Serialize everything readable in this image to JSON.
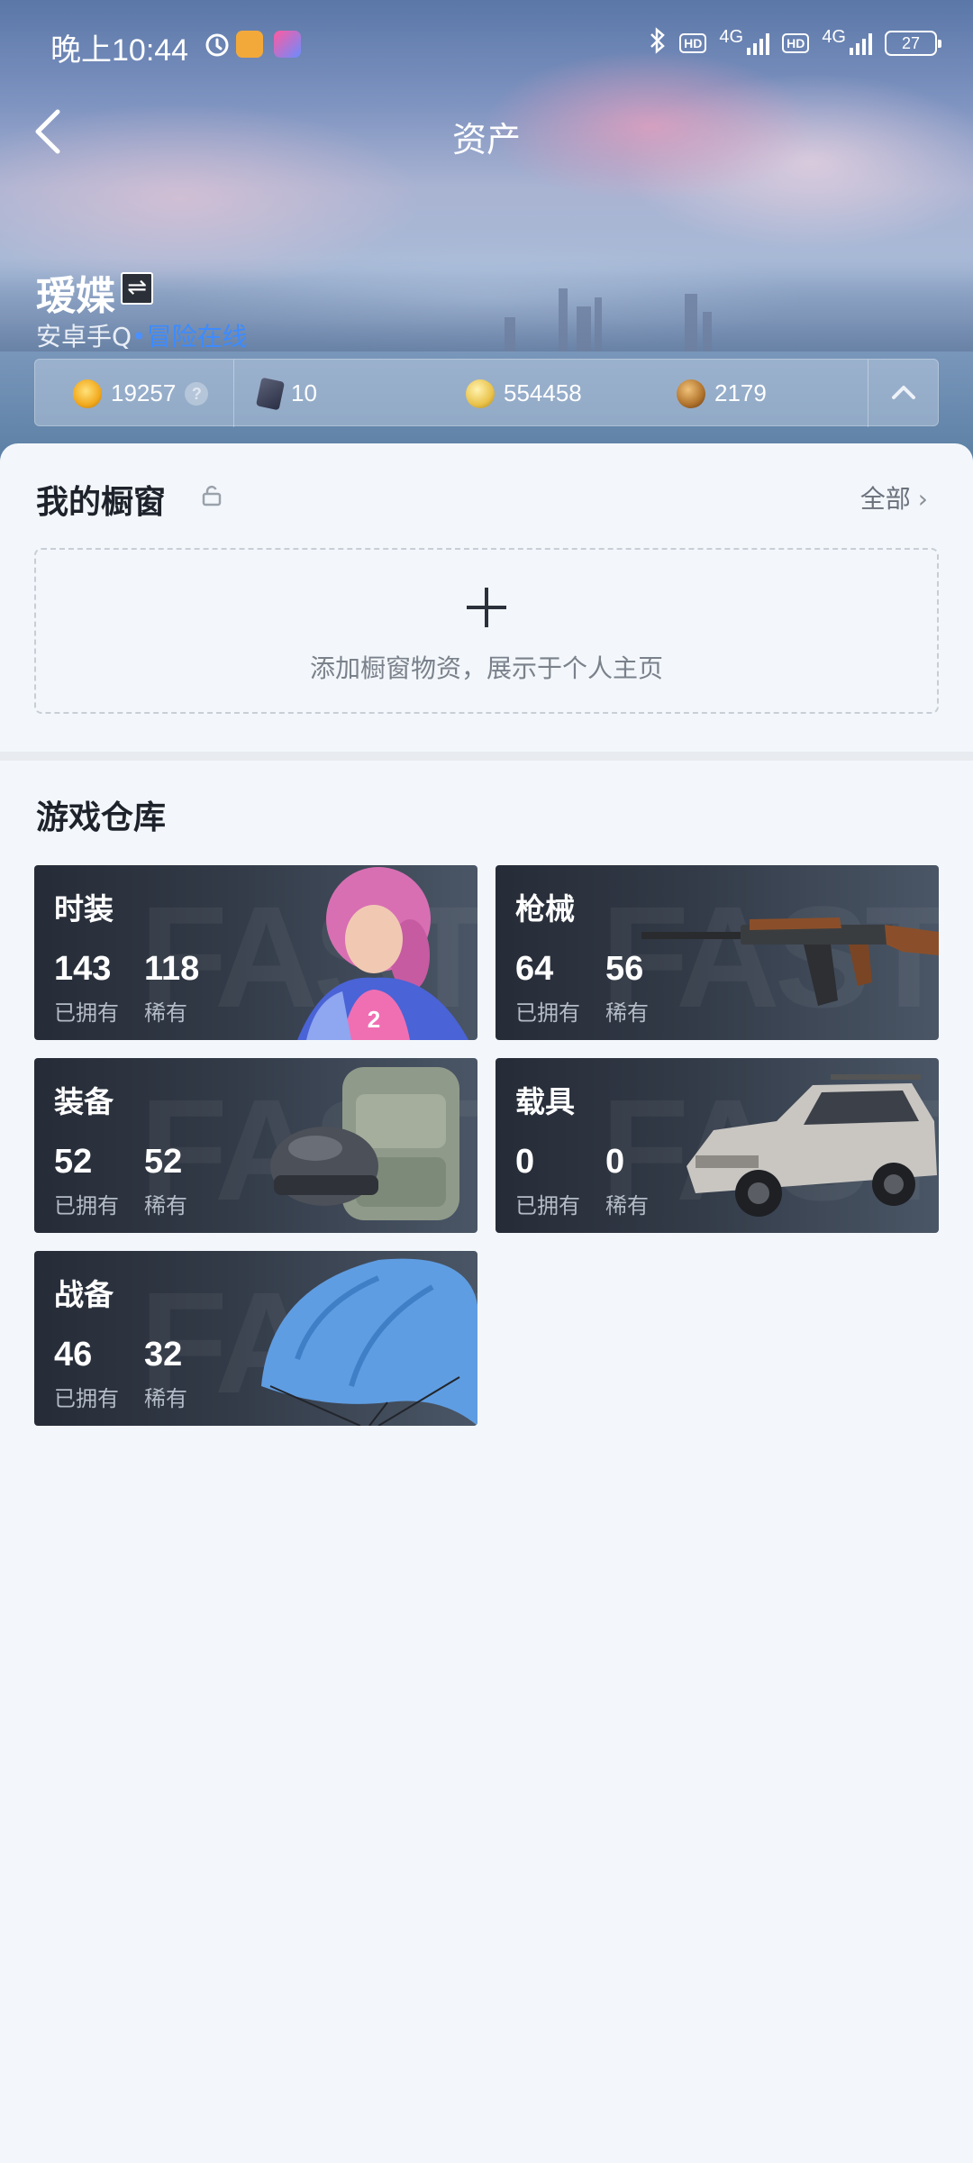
{
  "status_bar": {
    "time": "晚上10:44",
    "network_1": "4G",
    "network_2": "4G",
    "hd_1": "HD",
    "hd_2": "HD",
    "battery": "27"
  },
  "nav": {
    "title": "资产"
  },
  "profile": {
    "name": "瑷媟",
    "platform": "安卓手Q",
    "separator": "•",
    "status": "冒险在线"
  },
  "currency": {
    "items": [
      {
        "value": "19257",
        "help": "?",
        "icon": "flame-coin-icon"
      },
      {
        "value": "10",
        "icon": "card-icon"
      },
      {
        "value": "554458",
        "icon": "gold-coin-icon"
      },
      {
        "value": "2179",
        "icon": "bronze-coin-icon"
      }
    ]
  },
  "showcase": {
    "title": "我的橱窗",
    "see_all": "全部",
    "empty_hint": "添加橱窗物资，展示于个人主页"
  },
  "warehouse": {
    "title": "游戏仓库",
    "owned_label": "已拥有",
    "rare_label": "稀有",
    "watermark": "FAST",
    "categories": [
      {
        "name": "时装",
        "owned": "143",
        "rare": "118",
        "image": "character-outfit"
      },
      {
        "name": "枪械",
        "owned": "64",
        "rare": "56",
        "image": "rifle"
      },
      {
        "name": "装备",
        "owned": "52",
        "rare": "52",
        "image": "helmet-backpack"
      },
      {
        "name": "载具",
        "owned": "0",
        "rare": "0",
        "image": "car"
      },
      {
        "name": "战备",
        "owned": "46",
        "rare": "32",
        "image": "parachute"
      }
    ]
  },
  "colors": {
    "accent_blue": "#3d8bff",
    "panel_bg": "#f3f7fb",
    "card_dark": "#2a303b"
  }
}
